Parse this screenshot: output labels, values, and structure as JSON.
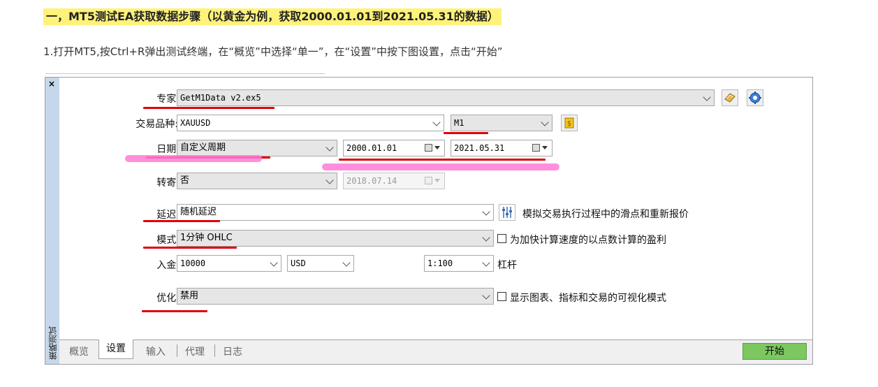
{
  "heading": "一，MT5测试EA获取数据步骤（以黄金为例，获取2000.01.01到2021.05.31的数据）",
  "step1": "1.打开MT5,按Ctrl+R弹出测试终端，在“概览”中选择“单一”，在“设置”中按下图设置，点击“开始”",
  "window": {
    "close": "×",
    "side_label": "策略测试"
  },
  "form": {
    "expert_label": "专家:",
    "expert_value": "GetM1Data v2.ex5",
    "symbol_label": "交易品种:",
    "symbol_value": "XAUUSD",
    "timeframe_value": "M1",
    "date_label": "日期:",
    "date_mode": "自定义周期",
    "date_from": "2000.01.01",
    "date_to": "2021.05.31",
    "forward_label": "转寄:",
    "forward_value": "否",
    "forward_date": "2018.07.14",
    "delay_label": "延迟:",
    "delay_value": "随机延迟",
    "delay_note": "模拟交易执行过程中的滑点和重新报价",
    "mode_label": "模式:",
    "mode_value": "1分钟 OHLC",
    "mode_note": "为加快计算速度的以点数计算的盈利",
    "deposit_label": "入金:",
    "deposit_value": "10000",
    "currency_value": "USD",
    "leverage_value": "1:100",
    "leverage_label": "杠杆",
    "optimization_label": "优化:",
    "optimization_value": "禁用",
    "visual_note": "显示图表、指标和交易的可视化模式"
  },
  "tabs": [
    "概览",
    "设置",
    "输入",
    "代理",
    "日志"
  ],
  "active_tab": "设置",
  "start_button": "开始",
  "colors": {
    "highlight": "#fff27a",
    "annotation_red": "#e0000a",
    "annotation_pink": "#ff7bd6",
    "start_green": "#7cc760"
  }
}
